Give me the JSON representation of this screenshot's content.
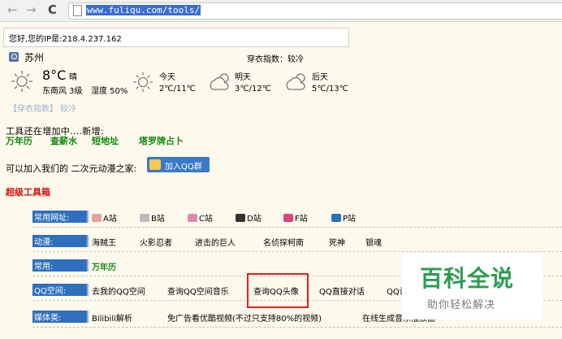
{
  "browser": {
    "url": "www.fuliqu.com/tools/"
  },
  "ip_text": "您好,您的IP是:218.4.237.162",
  "weather": {
    "city": "苏州",
    "clothes_index": "穿衣指数：较冷",
    "now": {
      "temp": "8°C",
      "cond": "晴",
      "wind": "东南风 3级",
      "humidity": "湿度 50%"
    },
    "today": {
      "label": "今天",
      "range": "2℃/11℃"
    },
    "tomorrow": {
      "label": "明天",
      "range": "3℃/12℃"
    },
    "after": {
      "label": "后天",
      "range": "5℃/13℃"
    },
    "link": "【穿衣指数】 较冷"
  },
  "growing": {
    "text": "工具还在增加中....新增:",
    "links": [
      "万年历",
      "查薪水",
      "短地址",
      "塔罗牌占卜"
    ]
  },
  "join": {
    "text": "可以加入我们的 二次元动漫之家:",
    "button": "加入QQ群"
  },
  "super_tools": "超级工具箱",
  "rows": {
    "common_sites": {
      "label": "常用网址:",
      "items": [
        "A站",
        "B站",
        "C站",
        "D站",
        "F站",
        "P站"
      ]
    },
    "anime": {
      "label": "动漫:",
      "items": [
        "海贼王",
        "火影忍者",
        "进击的巨人",
        "名侦探柯南",
        "死神",
        "银魂"
      ]
    },
    "common": {
      "label": "常用:",
      "items": [
        "万年历"
      ]
    },
    "qq": {
      "label": "QQ空间:",
      "items": [
        "去我的QQ空间",
        "查询QQ空间音乐",
        "查询QQ头像",
        "QQ直接对话",
        "QQ设"
      ]
    },
    "media": {
      "label": "媒体类:",
      "items": [
        "Bilibili解析",
        "免广告看优酷视频(不过只支持80%的视频)",
        "在线生成音乐播放器"
      ]
    }
  },
  "watermark": {
    "title": "百科全说",
    "subtitle": "助你轻松解决"
  },
  "colors": {
    "accent_blue": "#2f6fbd",
    "link_green": "#118a11",
    "title_red": "#cc1111",
    "watermark_green": "#2c9b52"
  }
}
